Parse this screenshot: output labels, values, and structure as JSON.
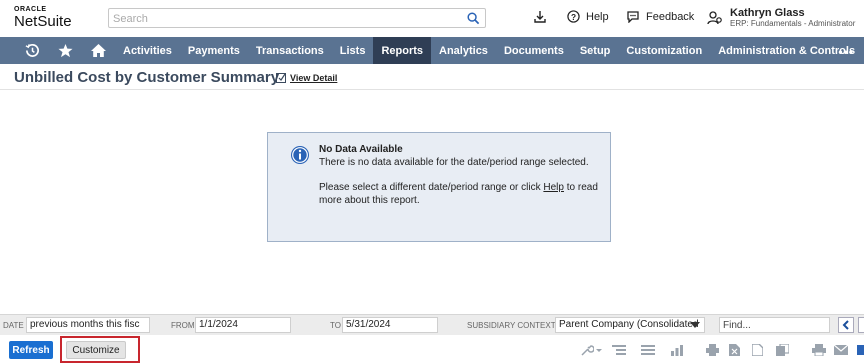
{
  "header": {
    "logo_top": "ORACLE",
    "logo_main": "NetSuite",
    "search_placeholder": "Search",
    "help_label": "Help",
    "feedback_label": "Feedback",
    "user_name": "Kathryn Glass",
    "user_role": "ERP: Fundamentals - Administrator"
  },
  "nav": {
    "icons": [
      "recent-records-icon",
      "star-icon",
      "home-icon"
    ],
    "items": [
      "Activities",
      "Payments",
      "Transactions",
      "Lists",
      "Reports",
      "Analytics",
      "Documents",
      "Setup",
      "Customization",
      "Administration & Controls"
    ],
    "active": "Reports",
    "more": "•••"
  },
  "page": {
    "title": "Unbilled Cost by Customer Summary",
    "view_detail": "View Detail"
  },
  "message": {
    "title": "No Data Available",
    "line1": "There is no data available for the date/period range selected.",
    "line2_pre": "Please select a different date/period range or click ",
    "line2_link": "Help",
    "line2_post": " to read more about this report."
  },
  "filters": {
    "date_label": "DATE",
    "date_value": "previous months this fisc",
    "from_label": "FROM",
    "from_value": "1/1/2024",
    "to_label": "TO",
    "to_value": "5/31/2024",
    "subsidiary_label": "SUBSIDIARY CONTEXT",
    "subsidiary_value": "Parent Company (Consolidated",
    "find_placeholder": "Find..."
  },
  "buttons": {
    "refresh": "Refresh",
    "customize": "Customize"
  },
  "colors": {
    "nav_bg": "#5a7392",
    "nav_active": "#2f3e55",
    "refresh_bg": "#1a6fd1",
    "highlight": "#c8262e",
    "info_blue": "#2a63b6"
  }
}
